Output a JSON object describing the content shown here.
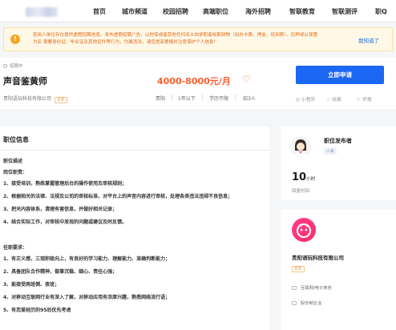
{
  "nav": {
    "items": [
      "首页",
      "城市频道",
      "校园招聘",
      "高端职位",
      "海外招聘",
      "智联教育",
      "智联测评",
      "职Q"
    ]
  },
  "notice": {
    "text": "若用人单位存在提供虚假招聘信息、发布虚假招聘广告，以担保或者其他任何名义向求职者收取财物（如办卡费、押金、培训费）、扣押或以保管为名 索要身份证、毕业证及其他证件等行为，均属违法，请您提高警惕并注意保护个人信息！",
    "link": "我知道了"
  },
  "job": {
    "status": "招聘中",
    "title": "声音鉴黄师",
    "salary": "4000-8000元/月",
    "apply": "立即申请",
    "company": "贵阳语玩科技有限公司",
    "company_tag": "企业",
    "city": "贵阳",
    "experience": "1年以下",
    "education": "学历不限",
    "headcount": "招3人",
    "actions": [
      "小程序",
      "收藏",
      "举报"
    ]
  },
  "main": {
    "section_title": "职位信息",
    "lines": [
      {
        "text": "职位描述",
        "bold": true
      },
      {
        "text": "岗位职责：",
        "bold": true
      },
      {
        "text": "1、接受培训，熟练掌握管理后台的操作使用及审核规则；",
        "bold": true
      },
      {
        "text": "2、根据相关的法律、法规及公司的审核标准，对平台上的声音内容进行审核，处理各类违法违规不良信息；",
        "bold": true
      },
      {
        "text": "3、把关内容体系，清理有害信息，并做好相关记录；",
        "bold": true
      },
      {
        "text": "4、结合实际工作，对审核中发现的问题或建议及时反馈。",
        "bold": true
      },
      {
        "text": "",
        "bold": false
      },
      {
        "text": "任职要求：",
        "bold": true
      },
      {
        "text": "1、有正义感，三观积极向上，有良好的学习能力、理解能力、准确判断能力；",
        "bold": true
      },
      {
        "text": "2、具备团队合作精神，做事沉稳、细心、责任心强；",
        "bold": true
      },
      {
        "text": "3、能接受两班倒、夜班；",
        "bold": true
      },
      {
        "text": "4、对移动互联网行业有深入了解，对移动应用有浓厚兴趣，熟悉网络流行语；",
        "bold": true
      },
      {
        "text": "5、有恋爱经历的95后优先考虑",
        "bold": true
      }
    ]
  },
  "publisher": {
    "title": "职位发布者",
    "tag": "人事",
    "response_time": "10",
    "response_unit": "小时",
    "response_label": "回复时间"
  },
  "company_card": {
    "name": "贵阳语玩科技有限公司",
    "tag": "企业",
    "industry": "互联网/电子商务",
    "type": "股份制企业"
  },
  "colors": {
    "accent": "#1b67f3",
    "salary": "#ff5d2d",
    "notice_text": "#e06a1a",
    "notice_bg": "#fff8e6"
  }
}
